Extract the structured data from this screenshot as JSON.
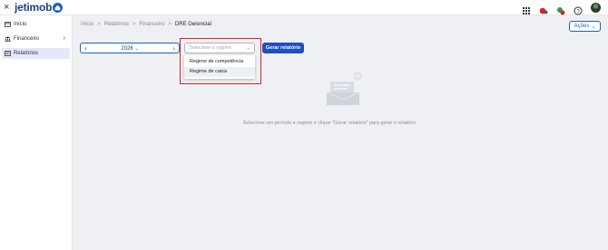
{
  "app": {
    "logo_text": "jetimob",
    "close_glyph": "×"
  },
  "sidebar": {
    "items": [
      {
        "label": "Início",
        "icon": "store-icon",
        "active": false
      },
      {
        "label": "Financeiro",
        "icon": "bank-icon",
        "active": false,
        "expandable": true
      },
      {
        "label": "Relatórios",
        "icon": "report-icon",
        "active": true
      }
    ]
  },
  "breadcrumb": {
    "items": [
      "Início",
      "Relatórios",
      "Financeiro",
      "DRE Gerencial"
    ],
    "separator": ">"
  },
  "header": {
    "actions_label": "Ações"
  },
  "filters": {
    "year": "2026",
    "regime_placeholder": "Selecione o regime",
    "regime_options": [
      "Regime de competência",
      "Regime de caixa"
    ],
    "hovered_option": "Regime de caixa",
    "generate_label": "Gerar relatório"
  },
  "empty_state": {
    "message": "Selecione um período e regime e clique \"Gerar relatório\" para gerar o relatório"
  },
  "colors": {
    "primary": "#1f4fc2",
    "highlight": "#d9232d",
    "background": "#eef0f4",
    "active_nav": "#e3e9f7"
  }
}
